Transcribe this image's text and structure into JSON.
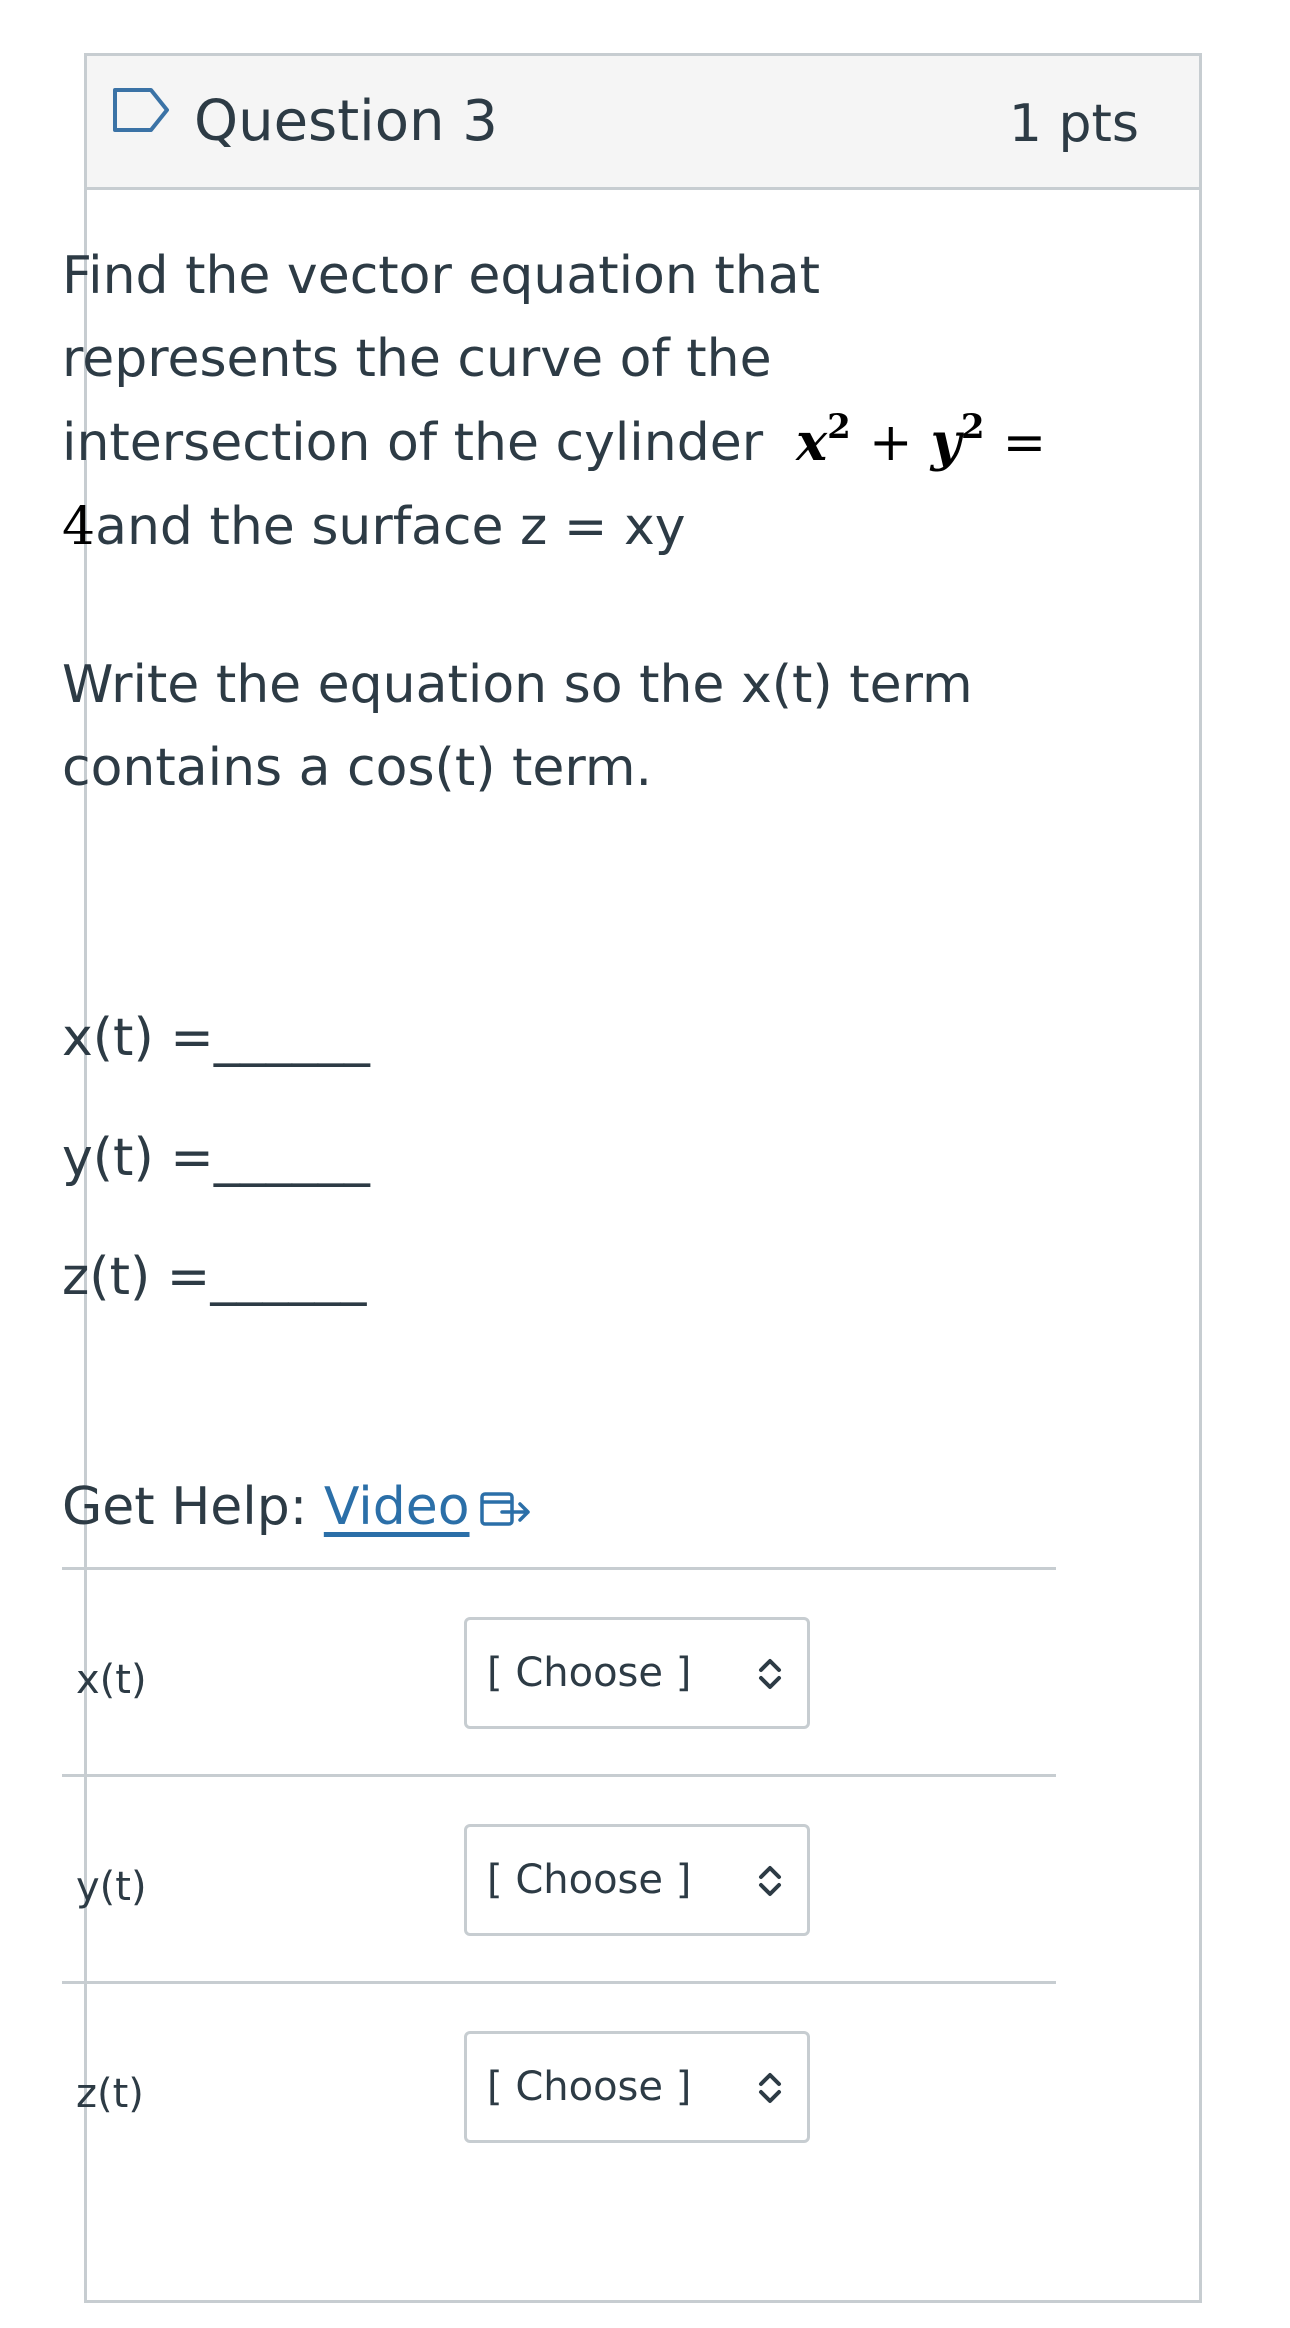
{
  "question": {
    "title": "Question 3",
    "points": "1 pts"
  },
  "prompt": {
    "line1_before": "Find the vector equation that represents the curve of the intersection of the cylinder",
    "math_x": "x",
    "math_y": "y",
    "math_exp": "2",
    "math_plus": "+",
    "math_eq": "=",
    "math_rhs": "4",
    "line1_after": "and the surface z = xy",
    "instruction": "Write the equation so the x(t)  term contains a cos(t) term."
  },
  "blanks": [
    "x(t) =______",
    "y(t) =______",
    "z(t) =______"
  ],
  "help": {
    "label": "Get Help: ",
    "link_text": "Video"
  },
  "answers": [
    {
      "label": "x(t)",
      "selected": "[ Choose ]"
    },
    {
      "label": "y(t)",
      "selected": "[ Choose ]"
    },
    {
      "label": "z(t)",
      "selected": "[ Choose ]"
    }
  ],
  "colors": {
    "text": "#2d3b45",
    "link": "#2b6fa8",
    "border": "#c7cdd1",
    "header_bg": "#f5f5f5"
  }
}
